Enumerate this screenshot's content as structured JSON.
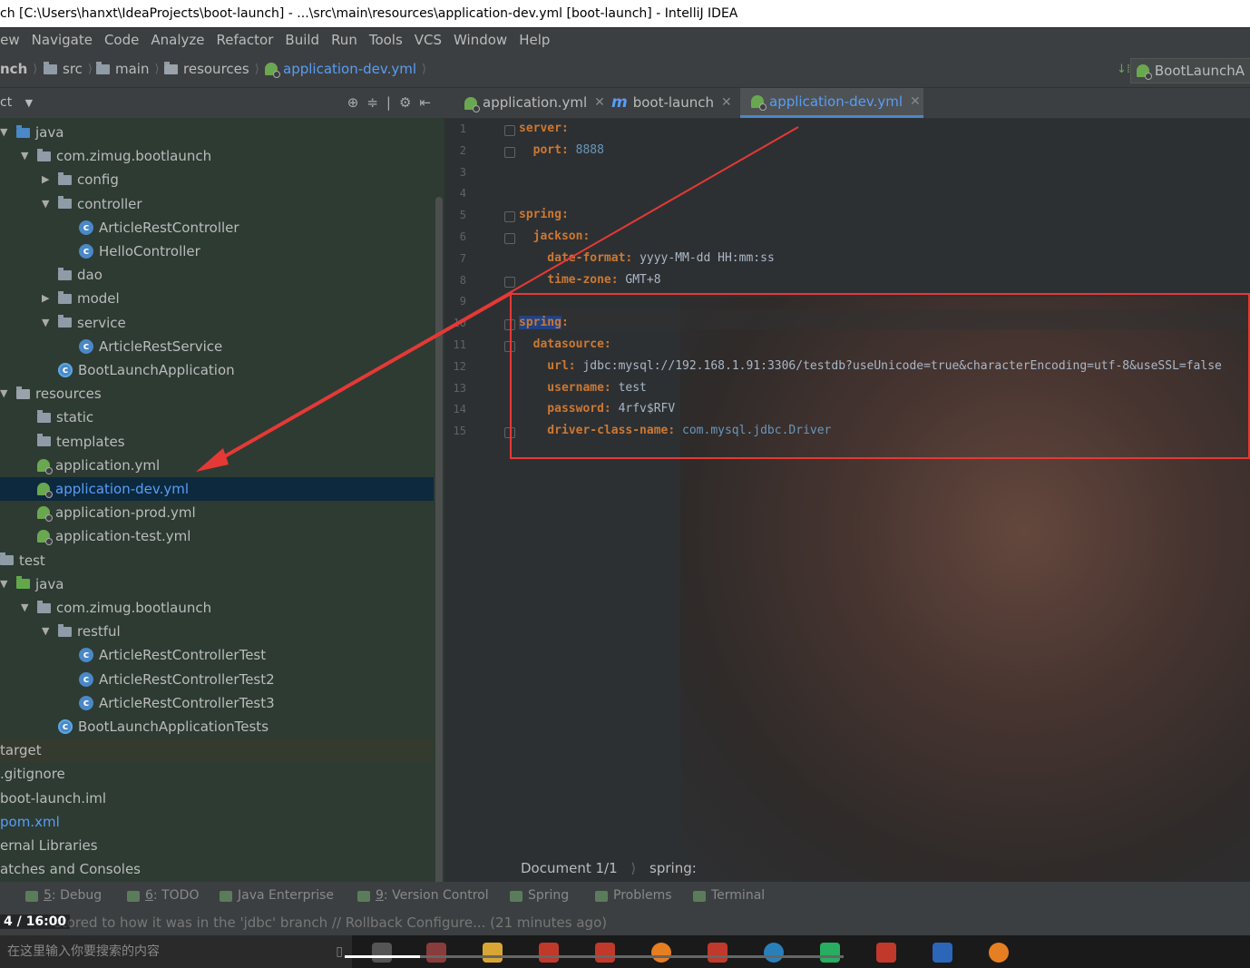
{
  "window": {
    "title": "ch [C:\\Users\\hanxt\\IdeaProjects\\boot-launch] - ...\\src\\main\\resources\\application-dev.yml [boot-launch] - IntelliJ IDEA"
  },
  "menu": [
    "iew",
    "Navigate",
    "Code",
    "Analyze",
    "Refactor",
    "Build",
    "Run",
    "Tools",
    "VCS",
    "Window",
    "Help"
  ],
  "nav": {
    "crumbs": [
      "nch",
      "src",
      "main",
      "resources",
      "application-dev.yml"
    ],
    "run_config": "BootLaunchA"
  },
  "project_panel": {
    "title": "ct",
    "tree": [
      {
        "label": "java",
        "arrow": "▼",
        "kind": "folder-blue",
        "indent": 0
      },
      {
        "label": "com.zimug.bootlaunch",
        "arrow": "▼",
        "kind": "folder",
        "indent": 1
      },
      {
        "label": "config",
        "arrow": "▶",
        "kind": "folder",
        "indent": 2
      },
      {
        "label": "controller",
        "arrow": "▼",
        "kind": "folder",
        "indent": 2
      },
      {
        "label": "ArticleRestController",
        "arrow": "",
        "kind": "class",
        "indent": 3
      },
      {
        "label": "HelloController",
        "arrow": "",
        "kind": "class",
        "indent": 3
      },
      {
        "label": "dao",
        "arrow": "",
        "kind": "folder",
        "indent": 2
      },
      {
        "label": "model",
        "arrow": "▶",
        "kind": "folder",
        "indent": 2
      },
      {
        "label": "service",
        "arrow": "▼",
        "kind": "folder",
        "indent": 2
      },
      {
        "label": "ArticleRestService",
        "arrow": "",
        "kind": "class",
        "indent": 3
      },
      {
        "label": "BootLaunchApplication",
        "arrow": "",
        "kind": "run-class",
        "indent": 2
      },
      {
        "label": "resources",
        "arrow": "▼",
        "kind": "folder-res",
        "indent": 0
      },
      {
        "label": "static",
        "arrow": "",
        "kind": "folder",
        "indent": 1
      },
      {
        "label": "templates",
        "arrow": "",
        "kind": "folder",
        "indent": 1
      },
      {
        "label": "application.yml",
        "arrow": "",
        "kind": "yml",
        "indent": 1
      },
      {
        "label": "application-dev.yml",
        "arrow": "",
        "kind": "yml",
        "indent": 1,
        "selected": true
      },
      {
        "label": "application-prod.yml",
        "arrow": "",
        "kind": "yml",
        "indent": 1
      },
      {
        "label": "application-test.yml",
        "arrow": "",
        "kind": "yml",
        "indent": 1
      },
      {
        "label": "test",
        "arrow": "",
        "kind": "folder",
        "indent": -1
      },
      {
        "label": "java",
        "arrow": "▼",
        "kind": "folder-green",
        "indent": 0
      },
      {
        "label": "com.zimug.bootlaunch",
        "arrow": "▼",
        "kind": "folder",
        "indent": 1
      },
      {
        "label": "restful",
        "arrow": "▼",
        "kind": "folder",
        "indent": 2
      },
      {
        "label": "ArticleRestControllerTest",
        "arrow": "",
        "kind": "class",
        "indent": 3
      },
      {
        "label": "ArticleRestControllerTest2",
        "arrow": "",
        "kind": "class",
        "indent": 3
      },
      {
        "label": "ArticleRestControllerTest3",
        "arrow": "",
        "kind": "class",
        "indent": 3
      },
      {
        "label": "BootLaunchApplicationTests",
        "arrow": "",
        "kind": "run-class",
        "indent": 2
      },
      {
        "label": "target",
        "arrow": "",
        "kind": "plain",
        "indent": -1,
        "dim": true
      },
      {
        "label": ".gitignore",
        "arrow": "",
        "kind": "plain",
        "indent": -1
      },
      {
        "label": "boot-launch.iml",
        "arrow": "",
        "kind": "plain",
        "indent": -1
      },
      {
        "label": "pom.xml",
        "arrow": "",
        "kind": "plain",
        "indent": -1,
        "blue": true
      },
      {
        "label": "ernal Libraries",
        "arrow": "",
        "kind": "plain",
        "indent": -1
      },
      {
        "label": "atches and Consoles",
        "arrow": "",
        "kind": "plain",
        "indent": -1
      }
    ]
  },
  "editor": {
    "tabs": [
      {
        "label": "application.yml",
        "kind": "yml",
        "active": false
      },
      {
        "label": "boot-launch",
        "kind": "maven",
        "active": false
      },
      {
        "label": "application-dev.yml",
        "kind": "yml",
        "active": true
      }
    ],
    "lines": [
      {
        "n": "1",
        "parts": [
          {
            "t": "server:",
            "c": "k"
          }
        ]
      },
      {
        "n": "2",
        "parts": [
          {
            "t": "  port: ",
            "c": "k"
          },
          {
            "t": "8888",
            "c": "vs"
          }
        ]
      },
      {
        "n": "3",
        "parts": []
      },
      {
        "n": "4",
        "parts": []
      },
      {
        "n": "5",
        "parts": [
          {
            "t": "spring:",
            "c": "k"
          }
        ]
      },
      {
        "n": "6",
        "parts": [
          {
            "t": "  jackson:",
            "c": "k"
          }
        ]
      },
      {
        "n": "7",
        "parts": [
          {
            "t": "    date-format: ",
            "c": "k"
          },
          {
            "t": "yyyy-MM-dd HH:mm:ss",
            "c": "v"
          }
        ]
      },
      {
        "n": "8",
        "parts": [
          {
            "t": "    time-zone: ",
            "c": "k"
          },
          {
            "t": "GMT+8",
            "c": "v"
          }
        ]
      },
      {
        "n": "9",
        "parts": []
      },
      {
        "n": "10",
        "parts": [
          {
            "t": "spring",
            "c": "k hl"
          },
          {
            "t": ":",
            "c": "k"
          }
        ]
      },
      {
        "n": "11",
        "parts": [
          {
            "t": "  datasource:",
            "c": "k"
          }
        ]
      },
      {
        "n": "12",
        "parts": [
          {
            "t": "    url: ",
            "c": "k"
          },
          {
            "t": "jdbc:mysql://192.168.1.91:3306/testdb?useUnicode=true&characterEncoding=utf-8&useSSL=false",
            "c": "v"
          }
        ]
      },
      {
        "n": "13",
        "parts": [
          {
            "t": "    username: ",
            "c": "k"
          },
          {
            "t": "test",
            "c": "v"
          }
        ]
      },
      {
        "n": "14",
        "parts": [
          {
            "t": "    password: ",
            "c": "k"
          },
          {
            "t": "4rfv$RFV",
            "c": "v"
          }
        ]
      },
      {
        "n": "15",
        "parts": [
          {
            "t": "    driver-class-name: ",
            "c": "k"
          },
          {
            "t": "com.mysql.jdbc.Driver",
            "c": "vs"
          }
        ]
      }
    ],
    "breadcrumb": [
      "Document 1/1",
      "spring:"
    ]
  },
  "tool_windows": [
    {
      "num": "5",
      "label": ": Debug"
    },
    {
      "num": "6",
      "label": ": TODO"
    },
    {
      "num": "",
      "label": "Java Enterprise"
    },
    {
      "num": "9",
      "label": ": Version Control"
    },
    {
      "num": "",
      "label": "Spring"
    },
    {
      "num": "",
      "label": "Problems"
    },
    {
      "num": "",
      "label": "Terminal"
    }
  ],
  "status": {
    "message": "stored to how it was in the 'jdbc' branch // Rollback Configure... (21 minutes ago)"
  },
  "video": {
    "timecode": "4 / 16:00",
    "progress": 0.15
  },
  "taskbar": {
    "search_text": "在这里输入你要搜索的内容"
  },
  "colors": {
    "keyword": "#cc7832",
    "value": "#a9b7c6",
    "number": "#6897bb",
    "selection": "#0d293e",
    "accent": "#589df6",
    "annotation": "#e53935"
  }
}
